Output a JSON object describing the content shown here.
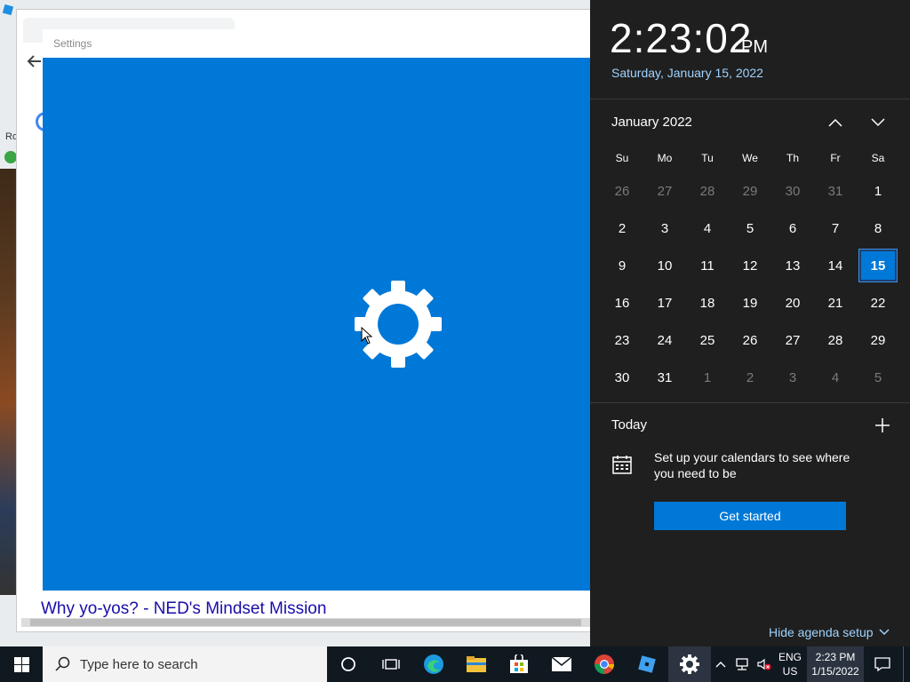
{
  "background": {
    "chrome_link": "Why yo-yos? - NED's Mindset Mission",
    "left_fragment_ro": "Ro"
  },
  "settings": {
    "title": "Settings",
    "accent": "#0078d7"
  },
  "clock": {
    "time": "2:23:02",
    "ampm": "PM",
    "date": "Saturday, January 15, 2022"
  },
  "calendar": {
    "month": "January 2022",
    "weekdays": [
      "Su",
      "Mo",
      "Tu",
      "We",
      "Th",
      "Fr",
      "Sa"
    ],
    "weeks": [
      [
        "26",
        "27",
        "28",
        "29",
        "30",
        "31",
        "1"
      ],
      [
        "2",
        "3",
        "4",
        "5",
        "6",
        "7",
        "8"
      ],
      [
        "9",
        "10",
        "11",
        "12",
        "13",
        "14",
        "15"
      ],
      [
        "16",
        "17",
        "18",
        "19",
        "20",
        "21",
        "22"
      ],
      [
        "23",
        "24",
        "25",
        "26",
        "27",
        "28",
        "29"
      ],
      [
        "30",
        "31",
        "1",
        "2",
        "3",
        "4",
        "5"
      ]
    ],
    "selected": "15"
  },
  "agenda": {
    "today_label": "Today",
    "message": "Set up your calendars to see where you need to be",
    "get_started": "Get started",
    "hide_agenda": "Hide agenda setup"
  },
  "taskbar": {
    "search_placeholder": "Type here to search",
    "language_top": "ENG",
    "language_bottom": "US",
    "time": "2:23 PM",
    "date": "1/15/2022",
    "icons": [
      "cortana-icon",
      "task-view-icon",
      "edge-icon",
      "file-explorer-icon",
      "store-icon",
      "mail-icon",
      "chrome-icon",
      "roblox-studio-icon",
      "settings-icon"
    ]
  }
}
